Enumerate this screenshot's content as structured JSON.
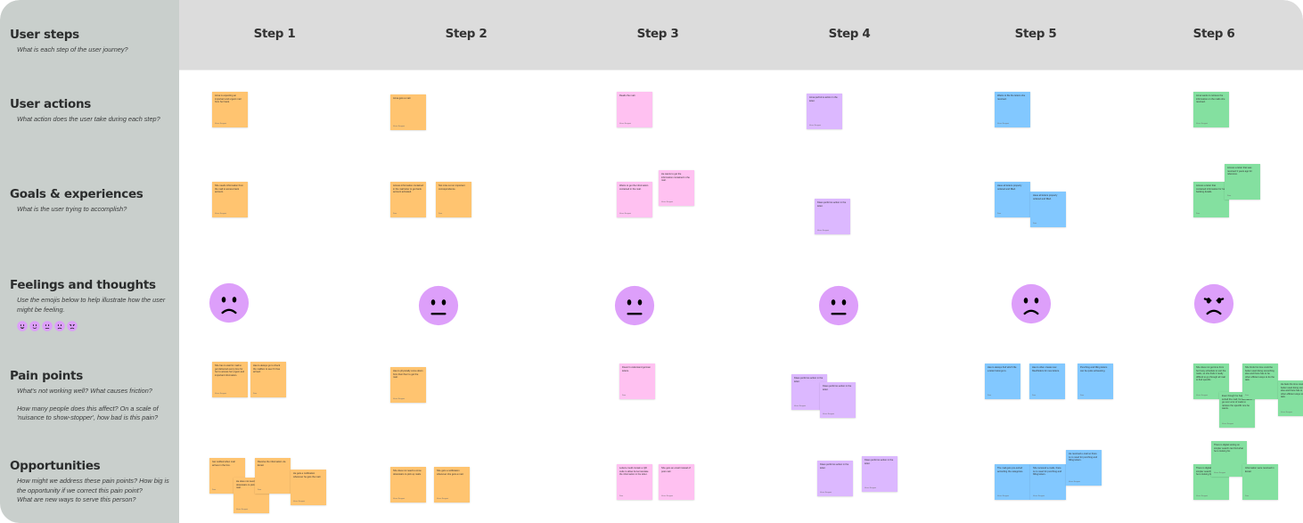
{
  "colors": {
    "orange": "#ffc470",
    "pink": "#ffc1f1",
    "lavender": "#dcb8ff",
    "blue": "#82c8ff",
    "green": "#84e0a0",
    "emoji_fill": "#dd9ffa",
    "sidebar": "#c9cfcc",
    "header": "#dcdcdc"
  },
  "rows": [
    {
      "title": "User steps",
      "desc": [
        "What is each step of the user journey?"
      ]
    },
    {
      "title": "User actions",
      "desc": [
        "What action does the user take during each step?"
      ]
    },
    {
      "title": "Goals & experiences",
      "desc": [
        "What is the user trying to accomplish?"
      ]
    },
    {
      "title": "Feelings and thoughts",
      "desc": [
        "Use the emojis below to help illustrate how the user might be feeling."
      ],
      "emoji_legend": [
        "very-happy",
        "happy",
        "neutral",
        "sad",
        "angry"
      ]
    },
    {
      "title": "Pain points",
      "desc": [
        "What's not working well? What causes friction?",
        "How many people does this affect? On a scale of 'nuisance to show-stopper', how bad is this pain?"
      ]
    },
    {
      "title": "Opportunities",
      "desc": [
        "How might we address these pain points? How big is the opportunity if we correct this pain point?",
        "What are new ways to serve this person?"
      ]
    }
  ],
  "steps": [
    "Step 1",
    "Step 2",
    "Step 3",
    "Step 4",
    "Step 5",
    "Step 6"
  ],
  "feelings": [
    "sad",
    "neutral",
    "neutral",
    "neutral",
    "sad",
    "angry"
  ],
  "stickies": [
    {
      "row": "actions",
      "step": 1,
      "color": "orange",
      "text": "Anna is expecting an important and urgent mail from her bank.",
      "author": "Varun Sangani"
    },
    {
      "row": "actions",
      "step": 2,
      "color": "orange",
      "text": "Anna gets a mail.",
      "author": "Varun Sangani"
    },
    {
      "row": "actions",
      "step": 3,
      "color": "pink",
      "text": "Reads the mail.",
      "author": "Varun Sangani"
    },
    {
      "row": "actions",
      "step": 4,
      "color": "lavender",
      "text": "Anna performs action in the letter.",
      "author": "Varun Sangani"
    },
    {
      "row": "actions",
      "step": 5,
      "color": "blue",
      "text": "Wants to file the letters she received.",
      "author": "Varun Sangani"
    },
    {
      "row": "actions",
      "step": 6,
      "color": "green",
      "text": "Anna wants to retrieve the information on the mails she received.",
      "author": "Varun Sangani"
    },
    {
      "row": "goals",
      "step": 1,
      "color": "orange",
      "text": "She needs information from the mail to access bank account.",
      "author": "Varun Sangani"
    },
    {
      "row": "goals",
      "step": 2,
      "color": "orange",
      "text": "Access information contained in the mail letter to get bank account activated.",
      "author": "Sam"
    },
    {
      "row": "goals",
      "step": 2,
      "color": "orange",
      "text": "Not miss out on important correspondence.",
      "author": "Sam"
    },
    {
      "row": "goals",
      "step": 3,
      "color": "pink",
      "text": "Wants to get the information contained in the mail.",
      "author": "Varun Sangani"
    },
    {
      "row": "goals",
      "step": 3,
      "color": "pink",
      "text": "He wants to get the information contained in the mail.",
      "author": "Varun Sangani"
    },
    {
      "row": "goals",
      "step": 4,
      "color": "lavender",
      "text": "Klaus performs action in the letter.",
      "author": "Varun Sangani"
    },
    {
      "row": "goals",
      "step": 5,
      "color": "blue",
      "text": "Have all letters properly ordered and filled.",
      "author": "Sam"
    },
    {
      "row": "goals",
      "step": 5,
      "color": "blue",
      "text": "Have all letters properly ordered and filled.",
      "author": "Sam"
    },
    {
      "row": "goals",
      "step": 6,
      "color": "green",
      "text": "Access a letter that contained information for her banking details.",
      "author": "Sam"
    },
    {
      "row": "goals",
      "step": 6,
      "color": "green",
      "text": "Access a letter that was received 3 years ago for reference.",
      "author": "Sam"
    },
    {
      "row": "pain",
      "step": 1,
      "color": "orange",
      "text": "She has to wait for mail to get delivered every time for her to access her urgent and important information.",
      "author": "Varun Sangani"
    },
    {
      "row": "pain",
      "step": 1,
      "color": "orange",
      "text": "Has to always go to check the mailbox to see if it has arrived.",
      "author": "Sam"
    },
    {
      "row": "pain",
      "step": 2,
      "color": "orange",
      "text": "Has to physically come down from their floor to get the mail.",
      "author": "Varun Sangani"
    },
    {
      "row": "pain",
      "step": 3,
      "color": "pink",
      "text": "Doesn't understand german letters.",
      "author": "Sam"
    },
    {
      "row": "pain",
      "step": 4,
      "color": "lavender",
      "text": "Klaus performs action in the letter.",
      "author": "Varun Sangani"
    },
    {
      "row": "pain",
      "step": 4,
      "color": "lavender",
      "text": "Klaus performs action in the letter.",
      "author": "Varun Sangani"
    },
    {
      "row": "pain",
      "step": 5,
      "color": "blue",
      "text": "Has to always find which file a letter belongs to.",
      "author": "Sam"
    },
    {
      "row": "pain",
      "step": 5,
      "color": "blue",
      "text": "Has to often create new files/folders for new letters.",
      "author": "Sam"
    },
    {
      "row": "pain",
      "step": 5,
      "color": "blue",
      "text": "Punching and filling letters can be quite exhausting.",
      "author": "Sam"
    },
    {
      "row": "pain",
      "step": 6,
      "color": "green",
      "text": "She does not get time from her busy schedule to sort the mails, so she finds it really difficult to go through all mail to find specific.",
      "author": "Varun Sangani"
    },
    {
      "row": "pain",
      "step": 6,
      "color": "green",
      "text": "Even though he has filed and sorted the mail, he still has to go over a lot of mails to retrieve the specific one he wants.",
      "author": "Varun Sangani"
    },
    {
      "row": "pain",
      "step": 6,
      "color": "green",
      "text": "She finds his time could be better used doing something else and there has to be other efficient ways to do the task.",
      "author": "Sam"
    },
    {
      "row": "pain",
      "step": 6,
      "color": "green",
      "text": "He feels his time could be better used doing something else and there has to be other efficient ways to do the task.",
      "author": "Varun Sangani"
    },
    {
      "row": "opp",
      "step": 1,
      "color": "orange",
      "text": "Get notified when mail arrives in the box.",
      "author": "Sam"
    },
    {
      "row": "opp",
      "step": 1,
      "color": "orange",
      "text": "He does not need to come downstairs to pick up the mail.",
      "author": "Varun Sangani"
    },
    {
      "row": "opp",
      "step": 1,
      "color": "orange",
      "text": "Receive the information via Email.",
      "author": "Sam"
    },
    {
      "row": "opp",
      "step": 1,
      "color": "orange",
      "text": "He gets a notification whenever he gets the mail.",
      "author": "Varun Sangani"
    },
    {
      "row": "opp",
      "step": 2,
      "color": "orange",
      "text": "She does not need to come downstairs to pick up mails.",
      "author": "Varun Sangani"
    },
    {
      "row": "opp",
      "step": 2,
      "color": "orange",
      "text": "She gets a notification whenever she gets a mail.",
      "author": "Varun Sangani"
    },
    {
      "row": "opp",
      "step": 3,
      "color": "pink",
      "text": "Letters could contain a QR code to allow Anna translate the information in the letter.",
      "author": "Sam"
    },
    {
      "row": "opp",
      "step": 3,
      "color": "pink",
      "text": "She gets an email instead of post mail.",
      "author": "Varun Sangani"
    },
    {
      "row": "opp",
      "step": 4,
      "color": "lavender",
      "text": "Klaus performs action in the letter.",
      "author": "Varun Sangani"
    },
    {
      "row": "opp",
      "step": 4,
      "color": "lavender",
      "text": "Klaus performs action in the letter.",
      "author": "Varun Sangani"
    },
    {
      "row": "opp",
      "step": 5,
      "color": "blue",
      "text": "The mail gets pre-sorted according the categories.",
      "author": "Varun Sangani"
    },
    {
      "row": "opp",
      "step": 5,
      "color": "blue",
      "text": "She received e-mails, there is no need for punching and filling letters.",
      "author": "Varun Sangani"
    },
    {
      "row": "opp",
      "step": 5,
      "color": "blue",
      "text": "He received e-mail so there is no need for punching and filling letters.",
      "author": "Varun Sangani"
    },
    {
      "row": "opp",
      "step": 6,
      "color": "green",
      "text": "There is digital sorting on simpler search can find what he is looking for.",
      "author": "Varun Sangani"
    },
    {
      "row": "opp",
      "step": 6,
      "color": "green",
      "text": "There is digital sorting on simpler search can find what he is looking for.",
      "author": "Varun Sangani"
    },
    {
      "row": "opp",
      "step": 6,
      "color": "green",
      "text": "Information were received in Email.",
      "author": "Sam"
    }
  ]
}
